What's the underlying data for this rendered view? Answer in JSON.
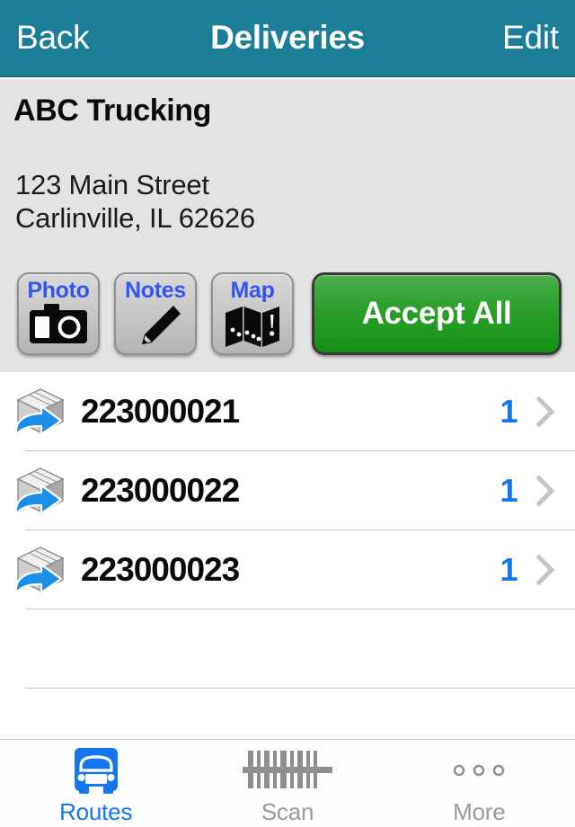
{
  "navbar": {
    "back_label": "Back",
    "title": "Deliveries",
    "edit_label": "Edit",
    "background_color": "#1b7e96",
    "text_color": "#ffffff"
  },
  "info": {
    "company": "ABC Trucking",
    "address_line1": "123 Main Street",
    "address_line2": "Carlinville, IL 62626",
    "background_color": "#e3e3e3"
  },
  "actions": {
    "photo_label": "Photo",
    "photo_icon": "camera-icon",
    "notes_label": "Notes",
    "notes_icon": "pencil-icon",
    "map_label": "Map",
    "map_icon": "folded-map-icon",
    "accept_all_label": "Accept All",
    "button_label_color": "#3355ee",
    "accept_color": "#2ea02e"
  },
  "deliveries": {
    "chevron_icon": "chevron-right-icon",
    "package_icon": "package-arrow-icon",
    "count_color": "#1577ef",
    "items": [
      {
        "code": "223000021",
        "count": "1"
      },
      {
        "code": "223000022",
        "count": "1"
      },
      {
        "code": "223000023",
        "count": "1"
      }
    ]
  },
  "tabbar": {
    "tabs": [
      {
        "label": "Routes",
        "icon": "truck-icon",
        "active": true
      },
      {
        "label": "Scan",
        "icon": "barcode-icon",
        "active": false
      },
      {
        "label": "More",
        "icon": "ellipsis-icon",
        "active": false
      }
    ],
    "active_color": "#1577ef",
    "inactive_color": "#9a9a9a"
  }
}
